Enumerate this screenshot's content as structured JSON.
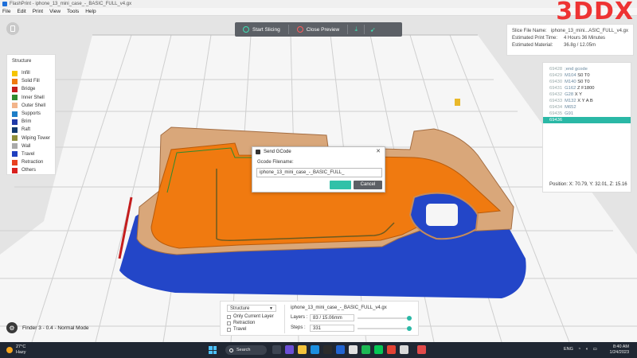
{
  "window": {
    "title": "FlashPrint - iphone_13_mini_case_-_BASIC_FULL_v4.gx"
  },
  "menu": [
    "File",
    "Edit",
    "Print",
    "View",
    "Tools",
    "Help"
  ],
  "toolbar": {
    "start_slicing": "Start Slicing",
    "close_preview": "Close Preview",
    "export_icon": "download-icon",
    "send_icon": "send-icon"
  },
  "brand": {
    "text": "3DDX"
  },
  "slice_info": {
    "rows": [
      {
        "label": "Slice File Name:",
        "value": "iphone_13_mini...ASIC_FULL_v4.gx"
      },
      {
        "label": "Estimated Print Time:",
        "value": "4 Hours 36 Minutes"
      },
      {
        "label": "Estimated Material:",
        "value": "36.8g / 12.05m"
      }
    ]
  },
  "gcode": {
    "lines": [
      {
        "no": "69428",
        "cmd": ";end gcode"
      },
      {
        "no": "69429",
        "cmd": "M104",
        "args": "S0 T0"
      },
      {
        "no": "69430",
        "cmd": "M140",
        "args": "S0 T0"
      },
      {
        "no": "69431",
        "cmd": "G162",
        "args": "Z F1800"
      },
      {
        "no": "69432",
        "cmd": "G28",
        "args": "X Y"
      },
      {
        "no": "69433",
        "cmd": "M132",
        "args": "X Y A B"
      },
      {
        "no": "69434",
        "cmd": "M652",
        "args": ""
      },
      {
        "no": "69435",
        "cmd": "G91",
        "args": ""
      },
      {
        "no": "69436",
        "cmd": "",
        "args": "",
        "selected": true
      }
    ],
    "position": "Position:  X: 70.79, Y: 32.01, Z: 15.16"
  },
  "legend": {
    "title": "Structure",
    "items": [
      {
        "label": "Infill",
        "color": "#f5c400"
      },
      {
        "label": "Solid Fill",
        "color": "#f07a10"
      },
      {
        "label": "Bridge",
        "color": "#c41e1e"
      },
      {
        "label": "Inner Shell",
        "color": "#2f8a2f"
      },
      {
        "label": "Outer Shell",
        "color": "#f2b48a"
      },
      {
        "label": "Supports",
        "color": "#1e7ec8"
      },
      {
        "label": "Brim",
        "color": "#203aa8"
      },
      {
        "label": "Raft",
        "color": "#123a6e"
      },
      {
        "label": "Wiping Tower",
        "color": "#8f8f3a"
      },
      {
        "label": "Wall",
        "color": "#aaaaaa"
      },
      {
        "label": "Travel",
        "color": "#1f3fbf"
      },
      {
        "label": "Retraction",
        "color": "#e8401f"
      },
      {
        "label": "Others",
        "color": "#d8201e"
      }
    ]
  },
  "layer_panel": {
    "view_mode": "Structure",
    "options": [
      "Only Current Layer",
      "Retraction",
      "Travel"
    ],
    "file_name": "iphone_13_mini_case_-_BASIC_FULL_v4.gx",
    "layers_label": "Layers :",
    "layers_value": "83 / 15.06mm",
    "steps_label": "Steps :",
    "steps_value": "331",
    "layers_fraction": 1.0,
    "steps_fraction": 1.0
  },
  "status": {
    "finder": "Finder 3 - 0.4 - Normal Mode"
  },
  "dialog": {
    "title": "Send GCode",
    "label": "Gcode Filename:",
    "filename": "iphone_13_mini_case_-_BASIC_FULL_",
    "ok": "",
    "cancel": "Cancel"
  },
  "taskbar": {
    "weather_temp": "27°C",
    "weather_text": "Hazy",
    "search": "Search",
    "lang": "ENG",
    "time": "8:40 AM",
    "date": "1/24/2023"
  }
}
